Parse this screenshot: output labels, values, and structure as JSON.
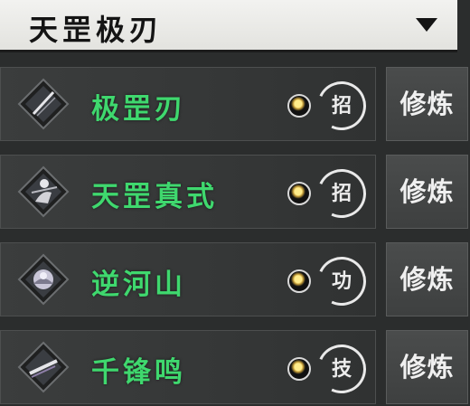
{
  "header": {
    "title": "天罡极刃",
    "dropdown_icon": "triangle-down-icon"
  },
  "colors": {
    "skill_name": "#3fd86e",
    "header_bg": "#f2f2f0",
    "panel_bg": "#2b2d2d"
  },
  "skills": [
    {
      "name": "极罡刃",
      "type_char": "招",
      "action": "修炼",
      "icon": "blade-slash-icon"
    },
    {
      "name": "天罡真式",
      "type_char": "招",
      "action": "修炼",
      "icon": "warrior-pose-icon"
    },
    {
      "name": "逆河山",
      "type_char": "功",
      "action": "修炼",
      "icon": "mountain-river-icon"
    },
    {
      "name": "千锋鸣",
      "type_char": "技",
      "action": "修炼",
      "icon": "blade-sword-icon"
    }
  ]
}
